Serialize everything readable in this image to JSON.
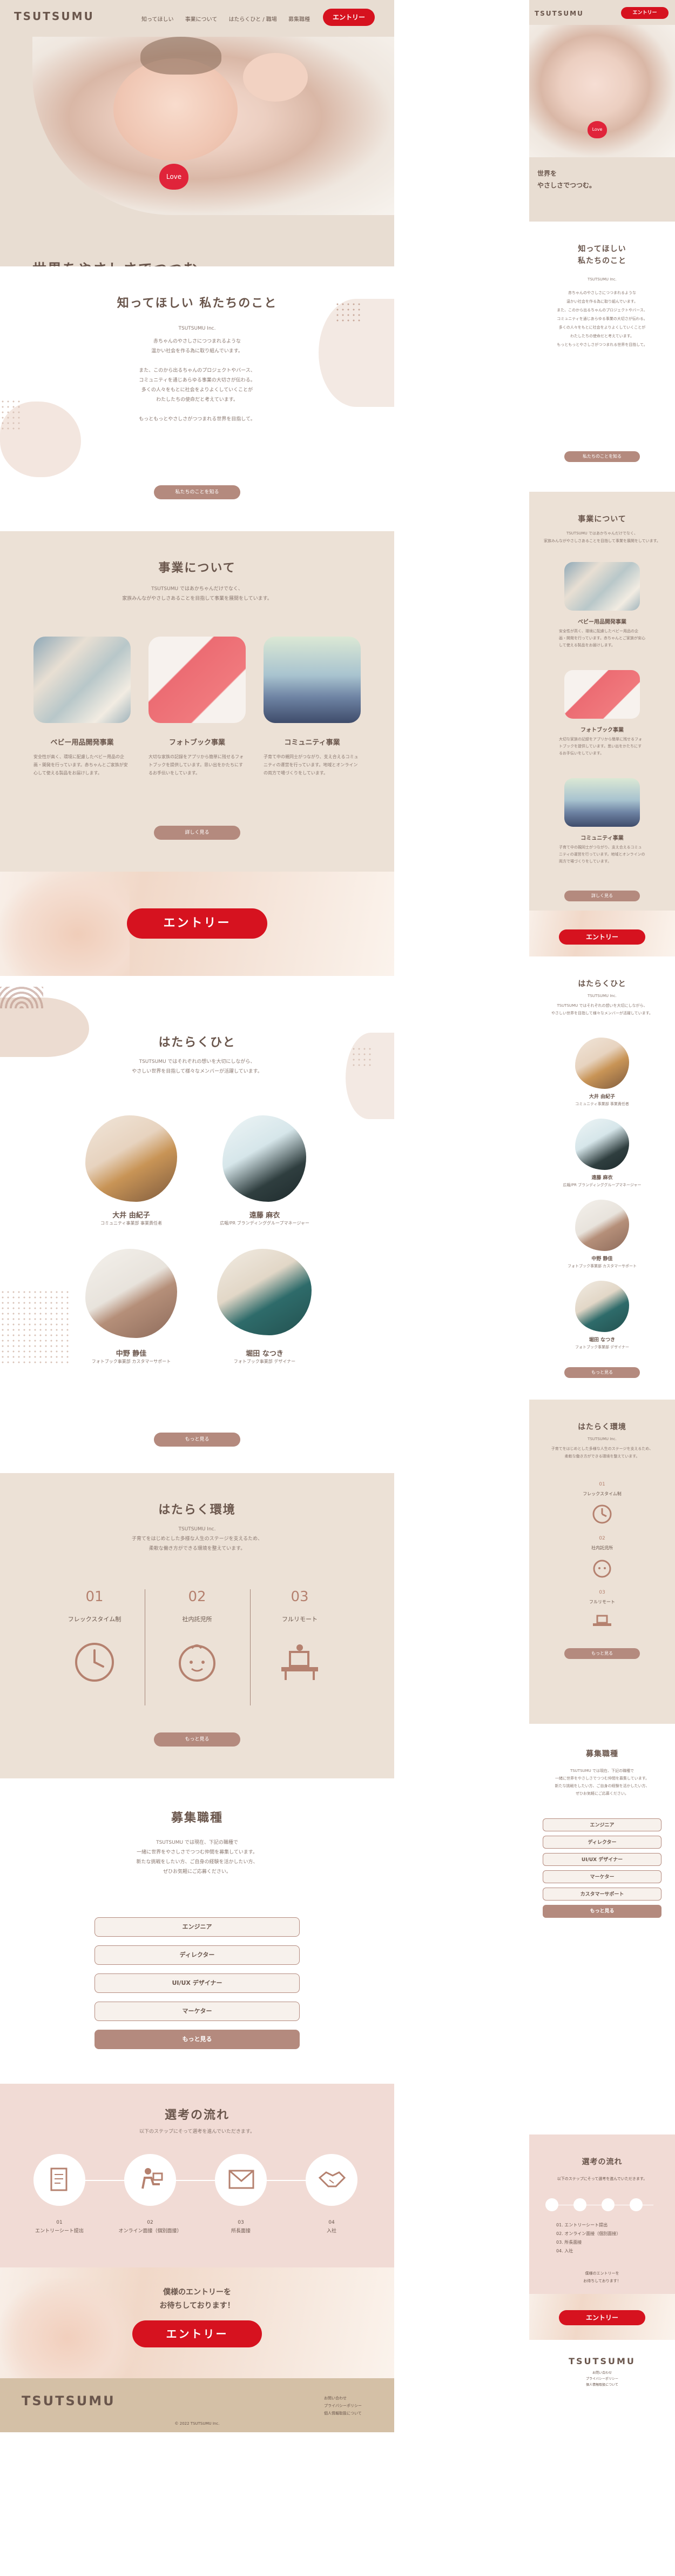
{
  "header": {
    "logo": "TSUTSUMU",
    "nav": [
      "知ってほしい",
      "事業について",
      "はたらくひと / 職場",
      "募集職種"
    ],
    "entry_label": "エントリー"
  },
  "hero": {
    "heart_text": "Love",
    "title": "世界をやさしさでつつむ。",
    "mobile_title_line1": "世界を",
    "mobile_title_line2": "やさしさでつつむ。"
  },
  "about": {
    "title": "知ってほしい 私たちのこと",
    "mobile_title_line1": "知ってほしい",
    "mobile_title_line2": "私たちのこと",
    "company": "TSUTSUMU Inc.",
    "lines": [
      "赤ちゃんのやさしさにつつまれるような",
      "温かい社会を作る為に取り組んでいます。",
      "",
      "また、このから出るちゃんのプロジェクトやバース、",
      "コミュニティを通じあらゆる事業の大切さが伝わる。",
      "多くの人々をもとに社会をよりよくしていくことが",
      "わたしたちの使命だと考えています。",
      "",
      "もっともっとやさしさがつつまれる世界を目指して。"
    ],
    "more": "私たちのことを知る"
  },
  "business": {
    "title": "事業について",
    "lead1": "TSUTSUMU ではあかちゃんだけでなく、",
    "lead2": "家族みんながやさしさあることを目指して事業を展開をしています。",
    "cards": [
      {
        "title": "ベビー用品開発事業",
        "text": "安全性が高く、環境に配慮したベビー用品の企画・開発を行っています。赤ちゃんとご家族が安心して使える製品をお届けします。"
      },
      {
        "title": "フォトブック事業",
        "text": "大切な家族の記録をアプリから簡単に残せるフォトブックを提供しています。思い出をかたちにするお手伝いをしています。"
      },
      {
        "title": "コミュニティ事業",
        "text": "子育て中の親同士がつながり、支え合えるコミュニティの運営を行っています。地域とオンラインの両方で場づくりをしています。"
      }
    ],
    "more": "詳しく見る"
  },
  "entry_band": {
    "label": "エントリー"
  },
  "people": {
    "title": "はたらくひと",
    "company": "TSUTSUMU Inc.",
    "lead1": "TSUTSUMU ではそれぞれの想いを大切にしながら、",
    "lead2": "やさしい世界を目指して様々なメンバーが活躍しています。",
    "members": [
      {
        "name": "大井 由紀子",
        "role": "コミュニティ事業部 事業責任者"
      },
      {
        "name": "遠藤 麻衣",
        "role": "広報/PR ブランディンググループマネージャー"
      },
      {
        "name": "中野 静佳",
        "role": "フォトブック事業部 カスタマーサポート"
      },
      {
        "name": "堀田 なつき",
        "role": "フォトブック事業部 デザイナー"
      }
    ],
    "more": "もっと見る"
  },
  "environment": {
    "title": "はたらく環境",
    "company": "TSUTSUMU Inc.",
    "lead1": "子育てをはじめとした多様な人生のステージを支えるため、",
    "lead2": "柔軟な働き方ができる環境を整えています。",
    "items": [
      {
        "num": "01",
        "label": "フレックスタイム制"
      },
      {
        "num": "02",
        "label": "社内託児所"
      },
      {
        "num": "03",
        "label": "フルリモート"
      }
    ],
    "more": "もっと見る"
  },
  "jobs": {
    "title": "募集職種",
    "lead": [
      "TSUTSUMU では現在、下記の職種で",
      "一緒に世界をやさしさでつつむ仲間を募集しています。",
      "新たな挑戦をしたい方、ご自身の経験を活かしたい方、",
      "ぜひお気軽にご応募ください。"
    ],
    "items": [
      "エンジニア",
      "ディレクター",
      "UI/UX デザイナー",
      "マーケター"
    ],
    "mobile_extra": "カスタマーサポート",
    "more": "もっと見る"
  },
  "flow": {
    "title": "選考の流れ",
    "lead": "以下のステップにそって選考を進んでいただきます。",
    "steps": [
      {
        "num": "01",
        "label": "エントリーシート提出"
      },
      {
        "num": "02",
        "label": "オンライン面接（個別面接）"
      },
      {
        "num": "03",
        "label": "所長面接"
      },
      {
        "num": "04",
        "label": "入社"
      }
    ]
  },
  "final_cta": {
    "line1": "僕様のエントリーを",
    "line2": "お待ちしております！",
    "label": "エントリー"
  },
  "footer": {
    "logo": "TSUTSUMU",
    "links": [
      "お問い合わせ",
      "プライバシーポリシー",
      "個人情報取扱について"
    ],
    "copyright": "© 2022 TSUTSUMU Inc."
  },
  "colors": {
    "beige": "#e8ddd2",
    "brown": "#b48a7e",
    "text": "#6a564c",
    "red": "#d6121f",
    "pink": "#f1dbd5",
    "footer": "#d4c0a6"
  }
}
